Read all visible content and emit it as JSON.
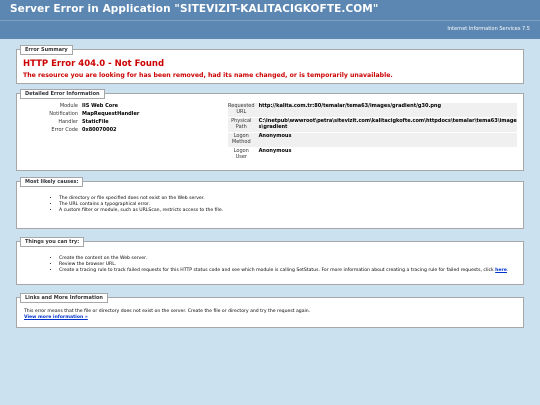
{
  "header": {
    "title": "Server Error in Application \"SITEVIZIT-KALITACIGKOFTE.COM\"",
    "server": "Internet Information Services 7.5"
  },
  "summary": {
    "legend": "Error Summary",
    "title": "HTTP Error 404.0 - Not Found",
    "description": "The resource you are looking for has been removed, had its name changed, or is temporarily unavailable."
  },
  "details": {
    "legend": "Detailed Error Information",
    "left": [
      {
        "label": "Module",
        "value": "IIS Web Core"
      },
      {
        "label": "Notification",
        "value": "MapRequestHandler"
      },
      {
        "label": "Handler",
        "value": "StaticFile"
      },
      {
        "label": "Error Code",
        "value": "0x80070002"
      }
    ],
    "right": [
      {
        "label": "Requested URL",
        "value": "http://kalita.com.tr:80/temalar/tema63/images/gradient/g30.png"
      },
      {
        "label": "Physical Path",
        "value": "C:\\inetpub\\wwwroot\\petra\\sitevizit.com\\kalitacigkofte.com\\httpdocs\\temalar\\tema63\\images\\gradient"
      },
      {
        "label": "Logon Method",
        "value": "Anonymous"
      },
      {
        "label": "Logon User",
        "value": "Anonymous"
      }
    ]
  },
  "causes": {
    "legend": "Most likely causes:",
    "items": [
      "The directory or file specified does not exist on the Web server.",
      "The URL contains a typographical error.",
      "A custom filter or module, such as URLScan, restricts access to the file."
    ]
  },
  "try": {
    "legend": "Things you can try:",
    "items": [
      "Create the content on the Web server.",
      "Review the browser URL."
    ],
    "tracing_text": "Create a tracing rule to track failed requests for this HTTP status code and see which module is calling SetStatus. For more information about creating a tracing rule for failed requests, click",
    "tracing_link": "here",
    "tracing_end": "."
  },
  "links": {
    "legend": "Links and More Information",
    "text": "This error means that the file or directory does not exist on the server. Create the file or directory and try the request again.",
    "more_link": "View more information »"
  }
}
